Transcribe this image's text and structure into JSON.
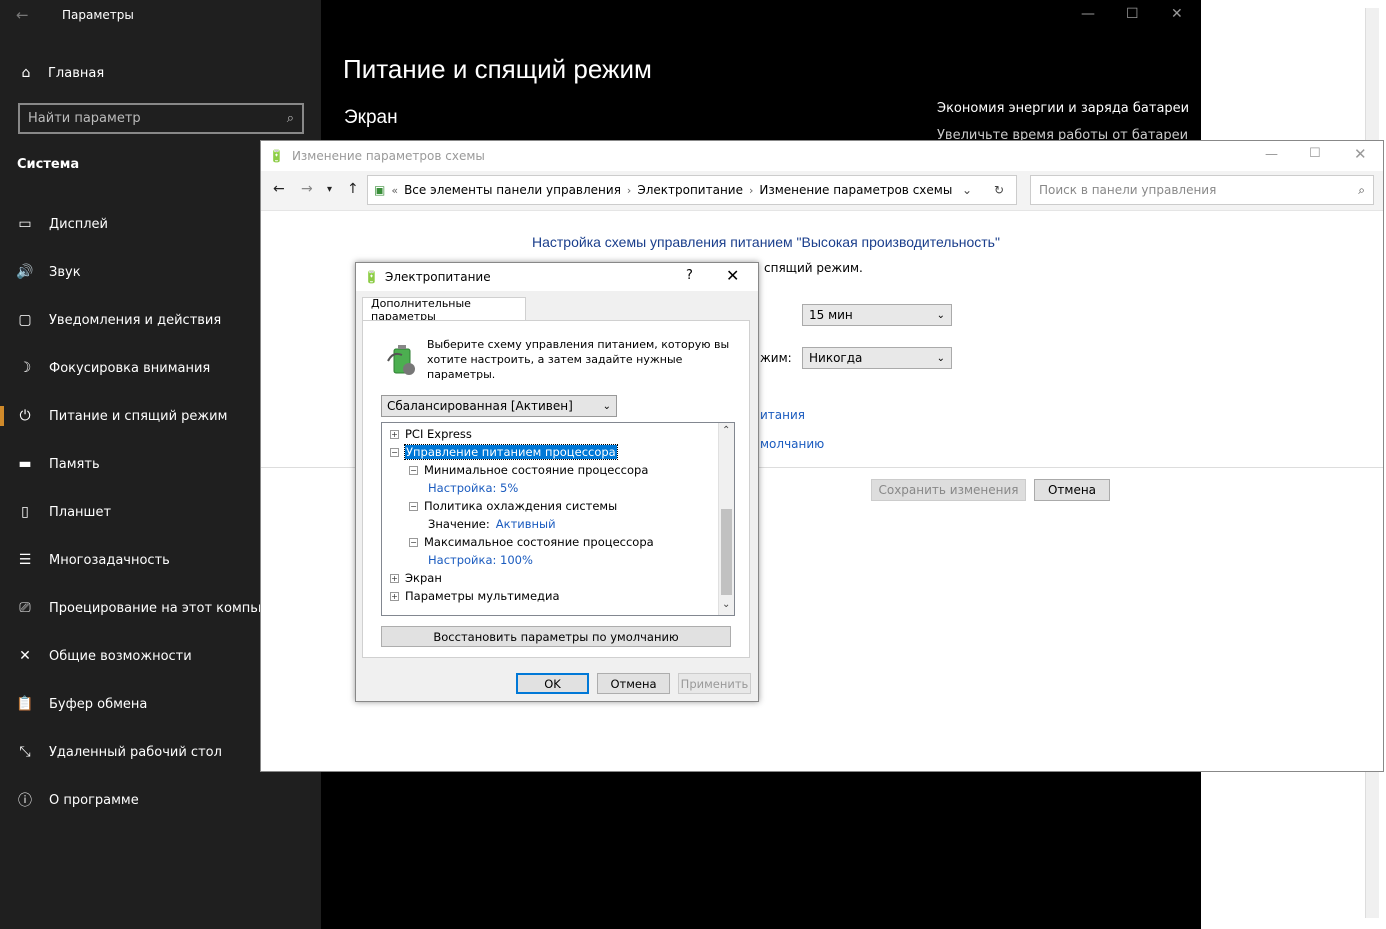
{
  "settings": {
    "app_title": "Параметры",
    "home_label": "Главная",
    "search_placeholder": "Найти параметр",
    "section_title": "Система",
    "nav": [
      {
        "label": "Дисплей",
        "icon": "monitor-icon",
        "active": false
      },
      {
        "label": "Звук",
        "icon": "speaker-icon",
        "active": false
      },
      {
        "label": "Уведомления и действия",
        "icon": "notification-icon",
        "active": false
      },
      {
        "label": "Фокусировка внимания",
        "icon": "moon-icon",
        "active": false
      },
      {
        "label": "Питание и спящий режим",
        "icon": "power-icon",
        "active": true
      },
      {
        "label": "Память",
        "icon": "storage-icon",
        "active": false
      },
      {
        "label": "Планшет",
        "icon": "tablet-icon",
        "active": false
      },
      {
        "label": "Многозадачность",
        "icon": "multitask-icon",
        "active": false
      },
      {
        "label": "Проецирование на этот компьют",
        "icon": "project-icon",
        "active": false
      },
      {
        "label": "Общие возможности",
        "icon": "shared-icon",
        "active": false
      },
      {
        "label": "Буфер обмена",
        "icon": "clipboard-icon",
        "active": false
      },
      {
        "label": "Удаленный рабочий стол",
        "icon": "remote-icon",
        "active": false
      },
      {
        "label": "О программе",
        "icon": "info-icon",
        "active": false
      }
    ],
    "page_title": "Питание и спящий режим",
    "screen_heading": "Экран",
    "energy_heading": "Экономия энергии и заряда батареи",
    "energy_sub": "Увеличьте время работы от батареи"
  },
  "control_panel": {
    "window_title": "Изменение параметров схемы",
    "breadcrumb": [
      "Все элементы панели управления",
      "Электропитание",
      "Изменение параметров схемы"
    ],
    "search_placeholder": "Поиск в панели управления",
    "heading": "Настройка схемы управления питанием \"Высокая производительность\"",
    "partial_text": "спящий режим.",
    "display_off_value": "15 мин",
    "sleep_label_partial": "жим:",
    "sleep_value": "Никогда",
    "link_partial_1": "итания",
    "link_partial_2": "молчанию",
    "save_label": "Сохранить изменения",
    "cancel_label": "Отмена"
  },
  "dialog": {
    "title": "Электропитание",
    "help_label": "?",
    "tab_label": "Дополнительные параметры",
    "description": "Выберите схему управления питанием, которую вы хотите настроить, а затем задайте нужные параметры.",
    "plan_value": "Сбалансированная [Активен]",
    "tree": [
      {
        "text": "PCI Express",
        "expander": "+",
        "indent": 0,
        "selected": false
      },
      {
        "text": "Управление питанием процессора",
        "expander": "−",
        "indent": 0,
        "selected": true
      },
      {
        "text": "Минимальное состояние процессора",
        "expander": "−",
        "indent": 1,
        "selected": false
      },
      {
        "text": "Настройка: 5%",
        "expander": "",
        "indent": 2,
        "selected": false,
        "value": true
      },
      {
        "text": "Политика охлаждения системы",
        "expander": "−",
        "indent": 1,
        "selected": false
      },
      {
        "text": "Значение:",
        "extra": "Активный",
        "expander": "",
        "indent": 2,
        "selected": false
      },
      {
        "text": "Максимальное состояние процессора",
        "expander": "−",
        "indent": 1,
        "selected": false
      },
      {
        "text": "Настройка: 100%",
        "expander": "",
        "indent": 2,
        "selected": false,
        "value": true
      },
      {
        "text": "Экран",
        "expander": "+",
        "indent": 0,
        "selected": false
      },
      {
        "text": "Параметры мультимедиа",
        "expander": "+",
        "indent": 0,
        "selected": false
      }
    ],
    "restore_label": "Восстановить параметры по умолчанию",
    "ok_label": "OK",
    "cancel_label": "Отмена",
    "apply_label": "Применить"
  }
}
